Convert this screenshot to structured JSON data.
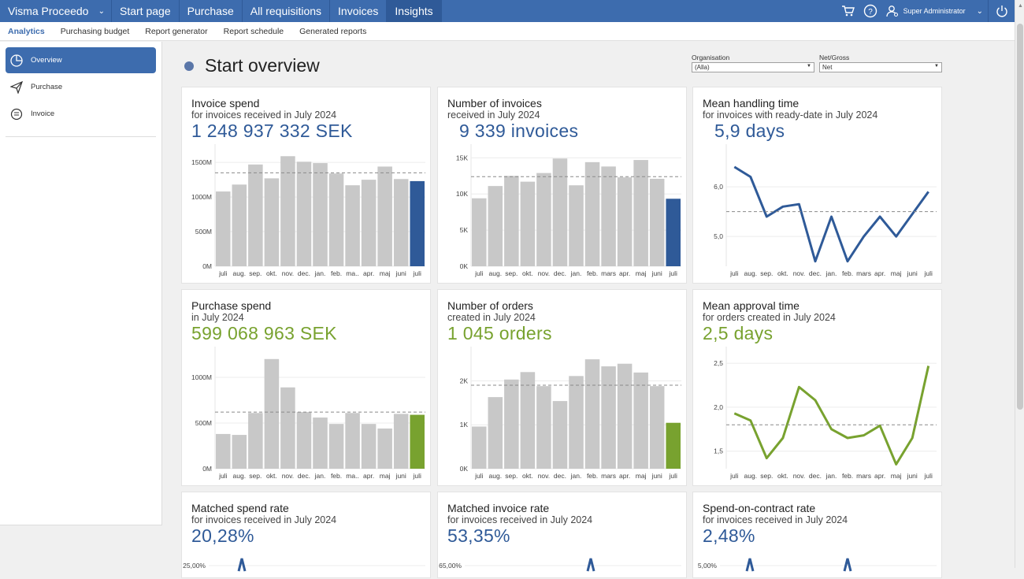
{
  "topbar": {
    "brand": "Visma Proceedo",
    "nav": [
      "Start page",
      "Purchase",
      "All requisitions",
      "Invoices",
      "Insights"
    ],
    "active_nav": "Insights",
    "user": "Super Administrator",
    "icons": [
      "cart-icon",
      "help-icon",
      "user-icon",
      "power-icon"
    ]
  },
  "subnav": [
    "Analytics",
    "Purchasing budget",
    "Report generator",
    "Report schedule",
    "Generated reports"
  ],
  "sidebar": {
    "items": [
      {
        "label": "Overview",
        "icon": "pie-chart-icon",
        "active": true
      },
      {
        "label": "Purchase",
        "icon": "paper-plane-icon",
        "active": false
      },
      {
        "label": "Invoice",
        "icon": "invoice-icon",
        "active": false
      }
    ]
  },
  "page": {
    "title": "Start overview"
  },
  "filters": {
    "organisation": {
      "label": "Organisation",
      "value": "(Alla)"
    },
    "netgross": {
      "label": "Net/Gross",
      "value": "Net"
    }
  },
  "colors": {
    "blue": "#2f5a98",
    "green": "#78a22f",
    "grey_bar": "#c8c8c8",
    "topbar": "#3d6cae"
  },
  "cards": [
    {
      "title": "Invoice spend",
      "subtitle": "for invoices received in July 2024",
      "kpi": "1 248 937 332 SEK",
      "color": "blue"
    },
    {
      "title": "Number of invoices",
      "subtitle": "received in July 2024",
      "kpi": "9 339 invoices",
      "color": "blue"
    },
    {
      "title": "Mean handling time",
      "subtitle": "for invoices with ready-date in July 2024",
      "kpi": "5,9 days",
      "color": "blue"
    },
    {
      "title": "Purchase spend",
      "subtitle": "in July 2024",
      "kpi": "599 068 963 SEK",
      "color": "green"
    },
    {
      "title": "Number of orders",
      "subtitle": "created in July 2024",
      "kpi": "1 045 orders",
      "color": "green"
    },
    {
      "title": "Mean approval time",
      "subtitle": "for orders created in July 2024",
      "kpi": "2,5 days",
      "color": "green"
    },
    {
      "title": "Matched spend rate",
      "subtitle": "for invoices received in July 2024",
      "kpi": "20,28%",
      "color": "blue"
    },
    {
      "title": "Matched invoice rate",
      "subtitle": "for invoices received in July 2024",
      "kpi": "53,35%",
      "color": "blue"
    },
    {
      "title": "Spend-on-contract rate",
      "subtitle": "for invoices received in July 2024",
      "kpi": "2,48%",
      "color": "blue"
    }
  ],
  "chart_data": [
    {
      "type": "bar",
      "categories": [
        "juli",
        "aug.",
        "sep.",
        "okt.",
        "nov.",
        "dec.",
        "jan.",
        "feb.",
        "ma..",
        "apr.",
        "maj",
        "juni",
        "juli"
      ],
      "values": [
        1080,
        1180,
        1470,
        1270,
        1590,
        1510,
        1490,
        1340,
        1170,
        1250,
        1440,
        1260,
        1230
      ],
      "average": 1350,
      "ylim": [
        0,
        1650
      ],
      "yticks": [
        {
          "v": 0,
          "label": "0M"
        },
        {
          "v": 500,
          "label": "500M"
        },
        {
          "v": 1000,
          "label": "1000M"
        },
        {
          "v": 1500,
          "label": "1500M"
        }
      ]
    },
    {
      "type": "bar",
      "categories": [
        "juli",
        "aug.",
        "sep.",
        "okt.",
        "nov.",
        "dec.",
        "jan.",
        "feb.",
        "mars",
        "apr.",
        "maj",
        "juni",
        "juli"
      ],
      "values": [
        9400,
        11100,
        12500,
        11700,
        12900,
        14900,
        11200,
        14400,
        13800,
        12300,
        14700,
        12100,
        9339
      ],
      "average": 12400,
      "ylim": [
        0,
        15800
      ],
      "yticks": [
        {
          "v": 0,
          "label": "0K"
        },
        {
          "v": 5000,
          "label": "5K"
        },
        {
          "v": 10000,
          "label": "10K"
        },
        {
          "v": 15000,
          "label": "15K"
        }
      ]
    },
    {
      "type": "line",
      "categories": [
        "juli",
        "aug.",
        "sep.",
        "okt.",
        "nov.",
        "dec.",
        "jan.",
        "feb.",
        "mars",
        "apr.",
        "maj",
        "juni",
        "juli"
      ],
      "values": [
        6.4,
        6.2,
        5.4,
        5.6,
        5.65,
        4.5,
        5.4,
        4.5,
        5.0,
        5.4,
        5.0,
        5.45,
        5.9
      ],
      "average": 5.5,
      "ylim": [
        4.4,
        6.7
      ],
      "yticks": [
        {
          "v": 5.0,
          "label": "5,0"
        },
        {
          "v": 6.0,
          "label": "6,0"
        }
      ]
    },
    {
      "type": "bar",
      "categories": [
        "juli",
        "aug.",
        "sep.",
        "okt.",
        "nov.",
        "dec.",
        "jan.",
        "feb.",
        "ma..",
        "apr.",
        "maj",
        "juni",
        "juli"
      ],
      "values": [
        380,
        370,
        610,
        1200,
        890,
        620,
        560,
        490,
        610,
        490,
        440,
        600,
        590
      ],
      "average": 620,
      "ylim": [
        0,
        1250
      ],
      "yticks": [
        {
          "v": 0,
          "label": "0M"
        },
        {
          "v": 500,
          "label": "500M"
        },
        {
          "v": 1000,
          "label": "1000M"
        }
      ]
    },
    {
      "type": "bar",
      "categories": [
        "juli",
        "aug.",
        "sep.",
        "okt.",
        "nov.",
        "dec.",
        "jan.",
        "feb.",
        "mars",
        "apr.",
        "maj",
        "juni",
        "juli"
      ],
      "values": [
        960,
        1630,
        2030,
        2200,
        1880,
        1540,
        2110,
        2490,
        2330,
        2390,
        2190,
        1880,
        1045
      ],
      "average": 1900,
      "ylim": [
        0,
        2600
      ],
      "yticks": [
        {
          "v": 0,
          "label": "0K"
        },
        {
          "v": 1000,
          "label": "1K"
        },
        {
          "v": 2000,
          "label": "2K"
        }
      ]
    },
    {
      "type": "line",
      "categories": [
        "juli",
        "aug.",
        "sep.",
        "okt.",
        "nov.",
        "dec.",
        "jan.",
        "feb.",
        "mars",
        "apr.",
        "maj",
        "juni",
        "juli"
      ],
      "values": [
        1.93,
        1.85,
        1.42,
        1.65,
        2.23,
        2.08,
        1.75,
        1.65,
        1.68,
        1.79,
        1.35,
        1.65,
        2.47
      ],
      "average": 1.8,
      "ylim": [
        1.3,
        2.6
      ],
      "yticks": [
        {
          "v": 1.5,
          "label": "1,5"
        },
        {
          "v": 2.0,
          "label": "2,0"
        },
        {
          "v": 2.5,
          "label": "2,5"
        }
      ]
    },
    {
      "type": "line",
      "partial": true,
      "yticks": [
        {
          "label": "25,00%"
        }
      ]
    },
    {
      "type": "line",
      "partial": true,
      "yticks": [
        {
          "label": "65,00%"
        }
      ]
    },
    {
      "type": "line",
      "partial": true,
      "yticks": [
        {
          "label": "5,00%"
        }
      ]
    }
  ]
}
